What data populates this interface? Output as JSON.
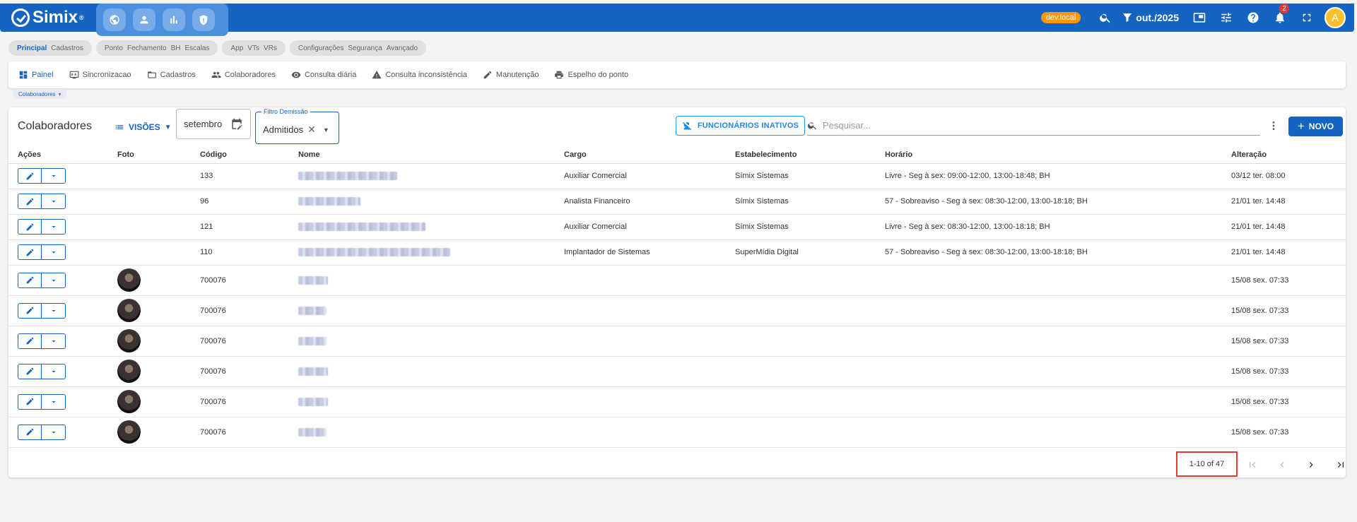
{
  "app": {
    "name": "Simix",
    "env_badge": "dev.local",
    "period": "out./2025",
    "notifications": "2",
    "avatar_letter": "A"
  },
  "modules": [
    {
      "items": [
        "Principal",
        "Cadastros"
      ]
    },
    {
      "items": [
        "Ponto",
        "Fechamento",
        "BH",
        "Escalas"
      ]
    },
    {
      "items": [
        "App",
        "VTs",
        "VRs"
      ]
    },
    {
      "items": [
        "Configurações",
        "Segurança",
        "Avançado"
      ]
    }
  ],
  "toolbar": {
    "painel": "Painel",
    "sincronizacao": "Sincronizacao",
    "cadastros": "Cadastros",
    "colaboradores": "Colaboradores",
    "consulta_diaria": "Consulta diária",
    "consulta_inconsistencia": "Consulta inconsistência",
    "manutencao": "Manutenção",
    "espelho": "Espelho do ponto"
  },
  "breadcrumb": "Colaboradores",
  "page": {
    "title": "Colaboradores",
    "visoes": "VISÕES",
    "month": "setembro",
    "filter_label": "Filtro Demissão",
    "filter_value": "Admitidos",
    "inativos": "FUNCIONÁRIOS INATIVOS",
    "search_placeholder": "Pesquisar...",
    "novo": "NOVO"
  },
  "table": {
    "headers": [
      "Ações",
      "Foto",
      "Código",
      "Nome",
      "Cargo",
      "Estabelecimento",
      "Horário",
      "Alteração"
    ],
    "rows": [
      {
        "codigo": "133",
        "cargo": "Auxiliar Comercial",
        "estab": "Símix Sistemas",
        "horario": "Livre - Seg à sex: 09:00-12:00, 13:00-18:48; BH",
        "alteracao": "03/12 ter. 08:00"
      },
      {
        "codigo": "96",
        "cargo": "Analista Financeiro",
        "estab": "Símix Sistemas",
        "horario": "57 - Sobreaviso - Seg à sex: 08:30-12:00, 13:00-18:18; BH",
        "alteracao": "21/01 ter. 14:48"
      },
      {
        "codigo": "121",
        "cargo": "Auxiliar Comercial",
        "estab": "Símix Sistemas",
        "horario": "Livre - Seg à sex: 08:30-12:00, 13:00-18:18; BH",
        "alteracao": "21/01 ter. 14:48"
      },
      {
        "codigo": "110",
        "cargo": "Implantador de Sistemas",
        "estab": "SuperMídia Digital",
        "horario": "57 - Sobreaviso - Seg à sex: 08:30-12:00, 13:00-18:18; BH",
        "alteracao": "21/01 ter. 14:48"
      },
      {
        "codigo": "700076",
        "cargo": "",
        "estab": "",
        "horario": "",
        "alteracao": "15/08 sex. 07:33"
      },
      {
        "codigo": "700076",
        "cargo": "",
        "estab": "",
        "horario": "",
        "alteracao": "15/08 sex. 07:33"
      },
      {
        "codigo": "700076",
        "cargo": "",
        "estab": "",
        "horario": "",
        "alteracao": "15/08 sex. 07:33"
      },
      {
        "codigo": "700076",
        "cargo": "",
        "estab": "",
        "horario": "",
        "alteracao": "15/08 sex. 07:33"
      },
      {
        "codigo": "700076",
        "cargo": "",
        "estab": "",
        "horario": "",
        "alteracao": "15/08 sex. 07:33"
      },
      {
        "codigo": "700076",
        "cargo": "",
        "estab": "",
        "horario": "",
        "alteracao": "15/08 sex. 07:33"
      }
    ]
  },
  "pagination": {
    "range": "1-10 of 47"
  },
  "colors": {
    "primary": "#1565c0",
    "accent": "#ff9800",
    "highlight": "#e53935"
  }
}
